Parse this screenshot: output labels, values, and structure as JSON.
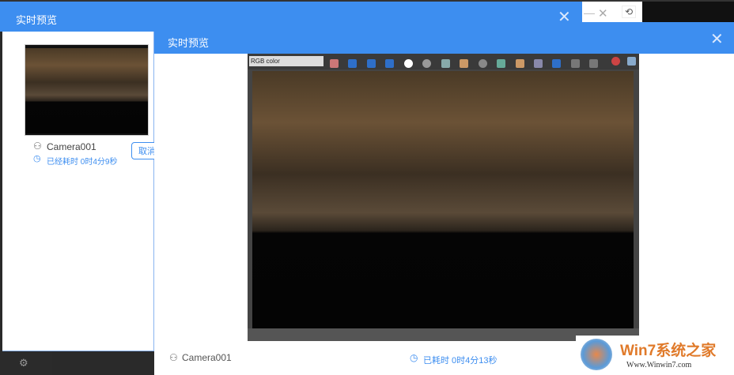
{
  "back_dialog": {
    "title": "实时预览",
    "camera": "Camera001",
    "elapsed": "已经耗时 0时4分9秒",
    "cancel_label": "取消"
  },
  "front_dialog": {
    "title": "实时预览",
    "camera": "Camera001",
    "elapsed": "已耗时 0时4分13秒"
  },
  "render_window": {
    "channel_select": "RGB color"
  },
  "watermark": {
    "brand": "Win7系统之家",
    "url": "Www.Winwin7.com"
  },
  "colors": {
    "accent": "#3d8ef0",
    "link": "#3d8ef0"
  }
}
